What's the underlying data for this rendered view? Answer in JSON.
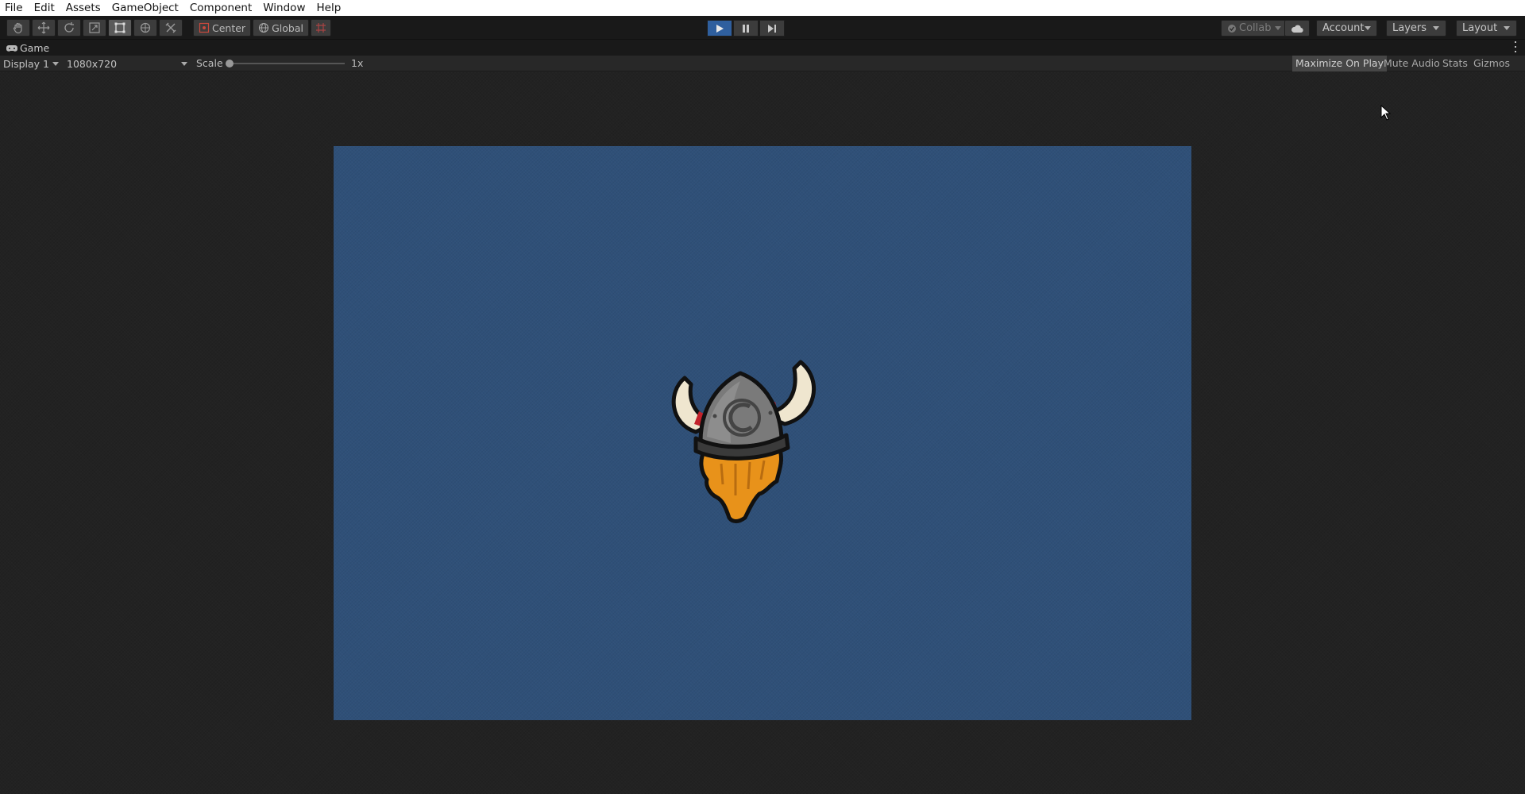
{
  "menubar": {
    "items": [
      "File",
      "Edit",
      "Assets",
      "GameObject",
      "Component",
      "Window",
      "Help"
    ]
  },
  "toolbar": {
    "tools": [
      {
        "name": "hand-tool-icon",
        "active": false
      },
      {
        "name": "move-tool-icon",
        "active": false
      },
      {
        "name": "rotate-tool-icon",
        "active": false
      },
      {
        "name": "scale-tool-icon",
        "active": false
      },
      {
        "name": "rect-tool-icon",
        "active": true
      },
      {
        "name": "transform-tool-icon",
        "active": false
      },
      {
        "name": "custom-tool-icon",
        "active": false
      }
    ],
    "pivot_label": "Center",
    "space_label": "Global",
    "collab_label": "Collab",
    "account_label": "Account",
    "layers_label": "Layers",
    "layout_label": "Layout",
    "play_active": true
  },
  "tab": {
    "label": "Game"
  },
  "gameview": {
    "display_label": "Display 1",
    "resolution_label": "1080x720",
    "scale_label": "Scale",
    "scale_value": "1x",
    "maximize_label": "Maximize On Play",
    "mute_label": "Mute Audio",
    "stats_label": "Stats",
    "gizmos_label": "Gizmos"
  },
  "colors": {
    "game_background": "#2f5078",
    "editor_background": "#222222",
    "play_active": "#2f5f9e"
  }
}
